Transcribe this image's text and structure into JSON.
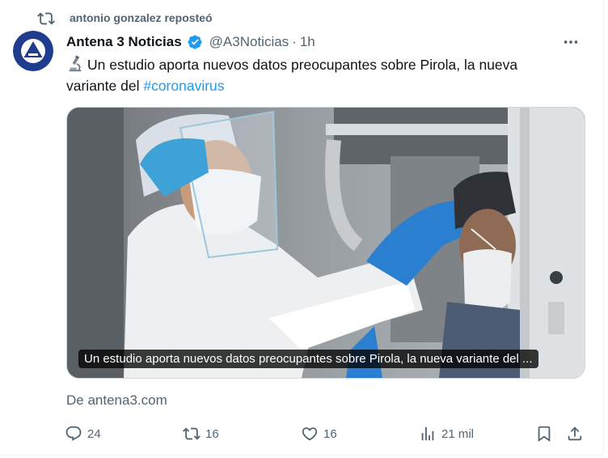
{
  "repost": {
    "icon": "repost-icon",
    "text": "antonio gonzalez reposteó"
  },
  "tweet": {
    "author": {
      "display_name": "Antena 3 Noticias",
      "verified": true,
      "handle": "@A3Noticias",
      "separator": "·",
      "time": "1h",
      "avatar_icon": "antena3-logo"
    },
    "text_before": "Un estudio aporta nuevos datos preocupantes sobre Pirola, la nueva variante del ",
    "hashtag": "#coronavirus",
    "leading_icon": "microscope-emoji",
    "media": {
      "caption": "Un estudio aporta nuevos datos preocupantes sobre Pirola, la nueva variante del ..."
    },
    "source": "De antena3.com",
    "actions": {
      "replies": "24",
      "reposts": "16",
      "likes": "16",
      "views": "21 mil"
    }
  },
  "colors": {
    "accent": "#1d9bf0",
    "secondary_text": "#536471",
    "primary_text": "#0f1419",
    "avatar_bg": "#1f3c8f"
  }
}
